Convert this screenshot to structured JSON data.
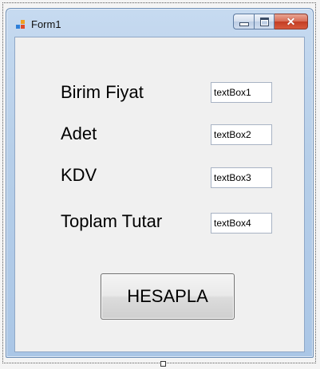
{
  "window": {
    "title": "Form1",
    "app_icon": "winforms-form-icon",
    "caption_buttons": {
      "minimize_icon": "minimize-icon",
      "maximize_icon": "maximize-icon",
      "close_icon": "close-icon"
    }
  },
  "form": {
    "fields": [
      {
        "label": "Birim Fiyat",
        "value": "textBox1"
      },
      {
        "label": "Adet",
        "value": "textBox2"
      },
      {
        "label": "KDV",
        "value": "textBox3"
      },
      {
        "label": "Toplam Tutar",
        "value": "textBox4"
      }
    ],
    "button_label": "HESAPLA"
  },
  "colors": {
    "titlebar": "#b7cfe9",
    "client_background": "#f0f0f0",
    "close_button": "#c33d23"
  }
}
